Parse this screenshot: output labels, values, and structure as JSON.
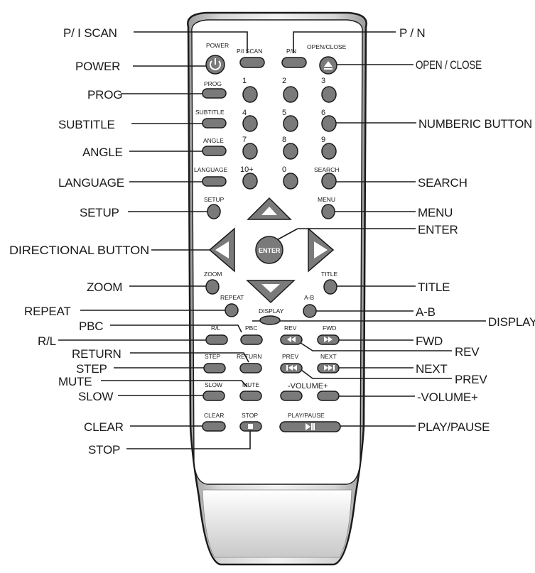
{
  "callouts_left": [
    {
      "id": "piscan",
      "text": "P/ I SCAN"
    },
    {
      "id": "power",
      "text": "POWER"
    },
    {
      "id": "prog",
      "text": "PROG"
    },
    {
      "id": "subtitle",
      "text": "SUBTITLE"
    },
    {
      "id": "angle",
      "text": "ANGLE"
    },
    {
      "id": "language",
      "text": "LANGUAGE"
    },
    {
      "id": "setup",
      "text": "SETUP"
    },
    {
      "id": "directional",
      "text": "DIRECTIONAL BUTTON"
    },
    {
      "id": "zoom",
      "text": "ZOOM"
    },
    {
      "id": "repeat",
      "text": "REPEAT"
    },
    {
      "id": "pbc",
      "text": "PBC"
    },
    {
      "id": "rl",
      "text": "R/L"
    },
    {
      "id": "return",
      "text": "RETURN"
    },
    {
      "id": "step",
      "text": "STEP"
    },
    {
      "id": "mute",
      "text": "MUTE"
    },
    {
      "id": "slow",
      "text": "SLOW"
    },
    {
      "id": "clear",
      "text": "CLEAR"
    },
    {
      "id": "stop",
      "text": "STOP"
    }
  ],
  "callouts_right": [
    {
      "id": "pn",
      "text": "P / N"
    },
    {
      "id": "openclose",
      "text": "OPEN / CLOSE"
    },
    {
      "id": "numeric",
      "text": "NUMBERIC BUTTON"
    },
    {
      "id": "search",
      "text": "SEARCH"
    },
    {
      "id": "menu",
      "text": "MENU"
    },
    {
      "id": "enter",
      "text": "ENTER"
    },
    {
      "id": "title",
      "text": "TITLE"
    },
    {
      "id": "ab",
      "text": "A-B"
    },
    {
      "id": "display",
      "text": "DISPLAY"
    },
    {
      "id": "fwd",
      "text": "FWD"
    },
    {
      "id": "rev",
      "text": "REV"
    },
    {
      "id": "next",
      "text": "NEXT"
    },
    {
      "id": "prev",
      "text": "PREV"
    },
    {
      "id": "volume",
      "text": "-VOLUME+"
    },
    {
      "id": "playpause",
      "text": "PLAY/PAUSE"
    }
  ],
  "button_labels": {
    "power": "POWER",
    "piscan": "P/I SCAN",
    "pn": "P/N",
    "openclose": "OPEN/CLOSE",
    "prog": "PROG",
    "subtitle": "SUBTITLE",
    "angle": "ANGLE",
    "language": "LANGUAGE",
    "n1": "1",
    "n2": "2",
    "n3": "3",
    "n4": "4",
    "n5": "5",
    "n6": "6",
    "n7": "7",
    "n8": "8",
    "n9": "9",
    "n10": "10+",
    "n0": "0",
    "search": "SEARCH",
    "setup": "SETUP",
    "menu": "MENU",
    "enter": "ENTER",
    "zoom": "ZOOM",
    "title": "TITLE",
    "repeat": "REPEAT",
    "ab": "A-B",
    "display": "DISPLAY",
    "rl": "R/L",
    "pbc": "PBC",
    "rev": "REV",
    "fwd": "FWD",
    "step": "STEP",
    "return": "RETURN",
    "prev": "PREV",
    "next": "NEXT",
    "slow": "SLOW",
    "mute": "MUTE",
    "volume": "-VOLUME+",
    "clear": "CLEAR",
    "stop": "STOP",
    "playpause": "PLAY/PAUSE"
  }
}
